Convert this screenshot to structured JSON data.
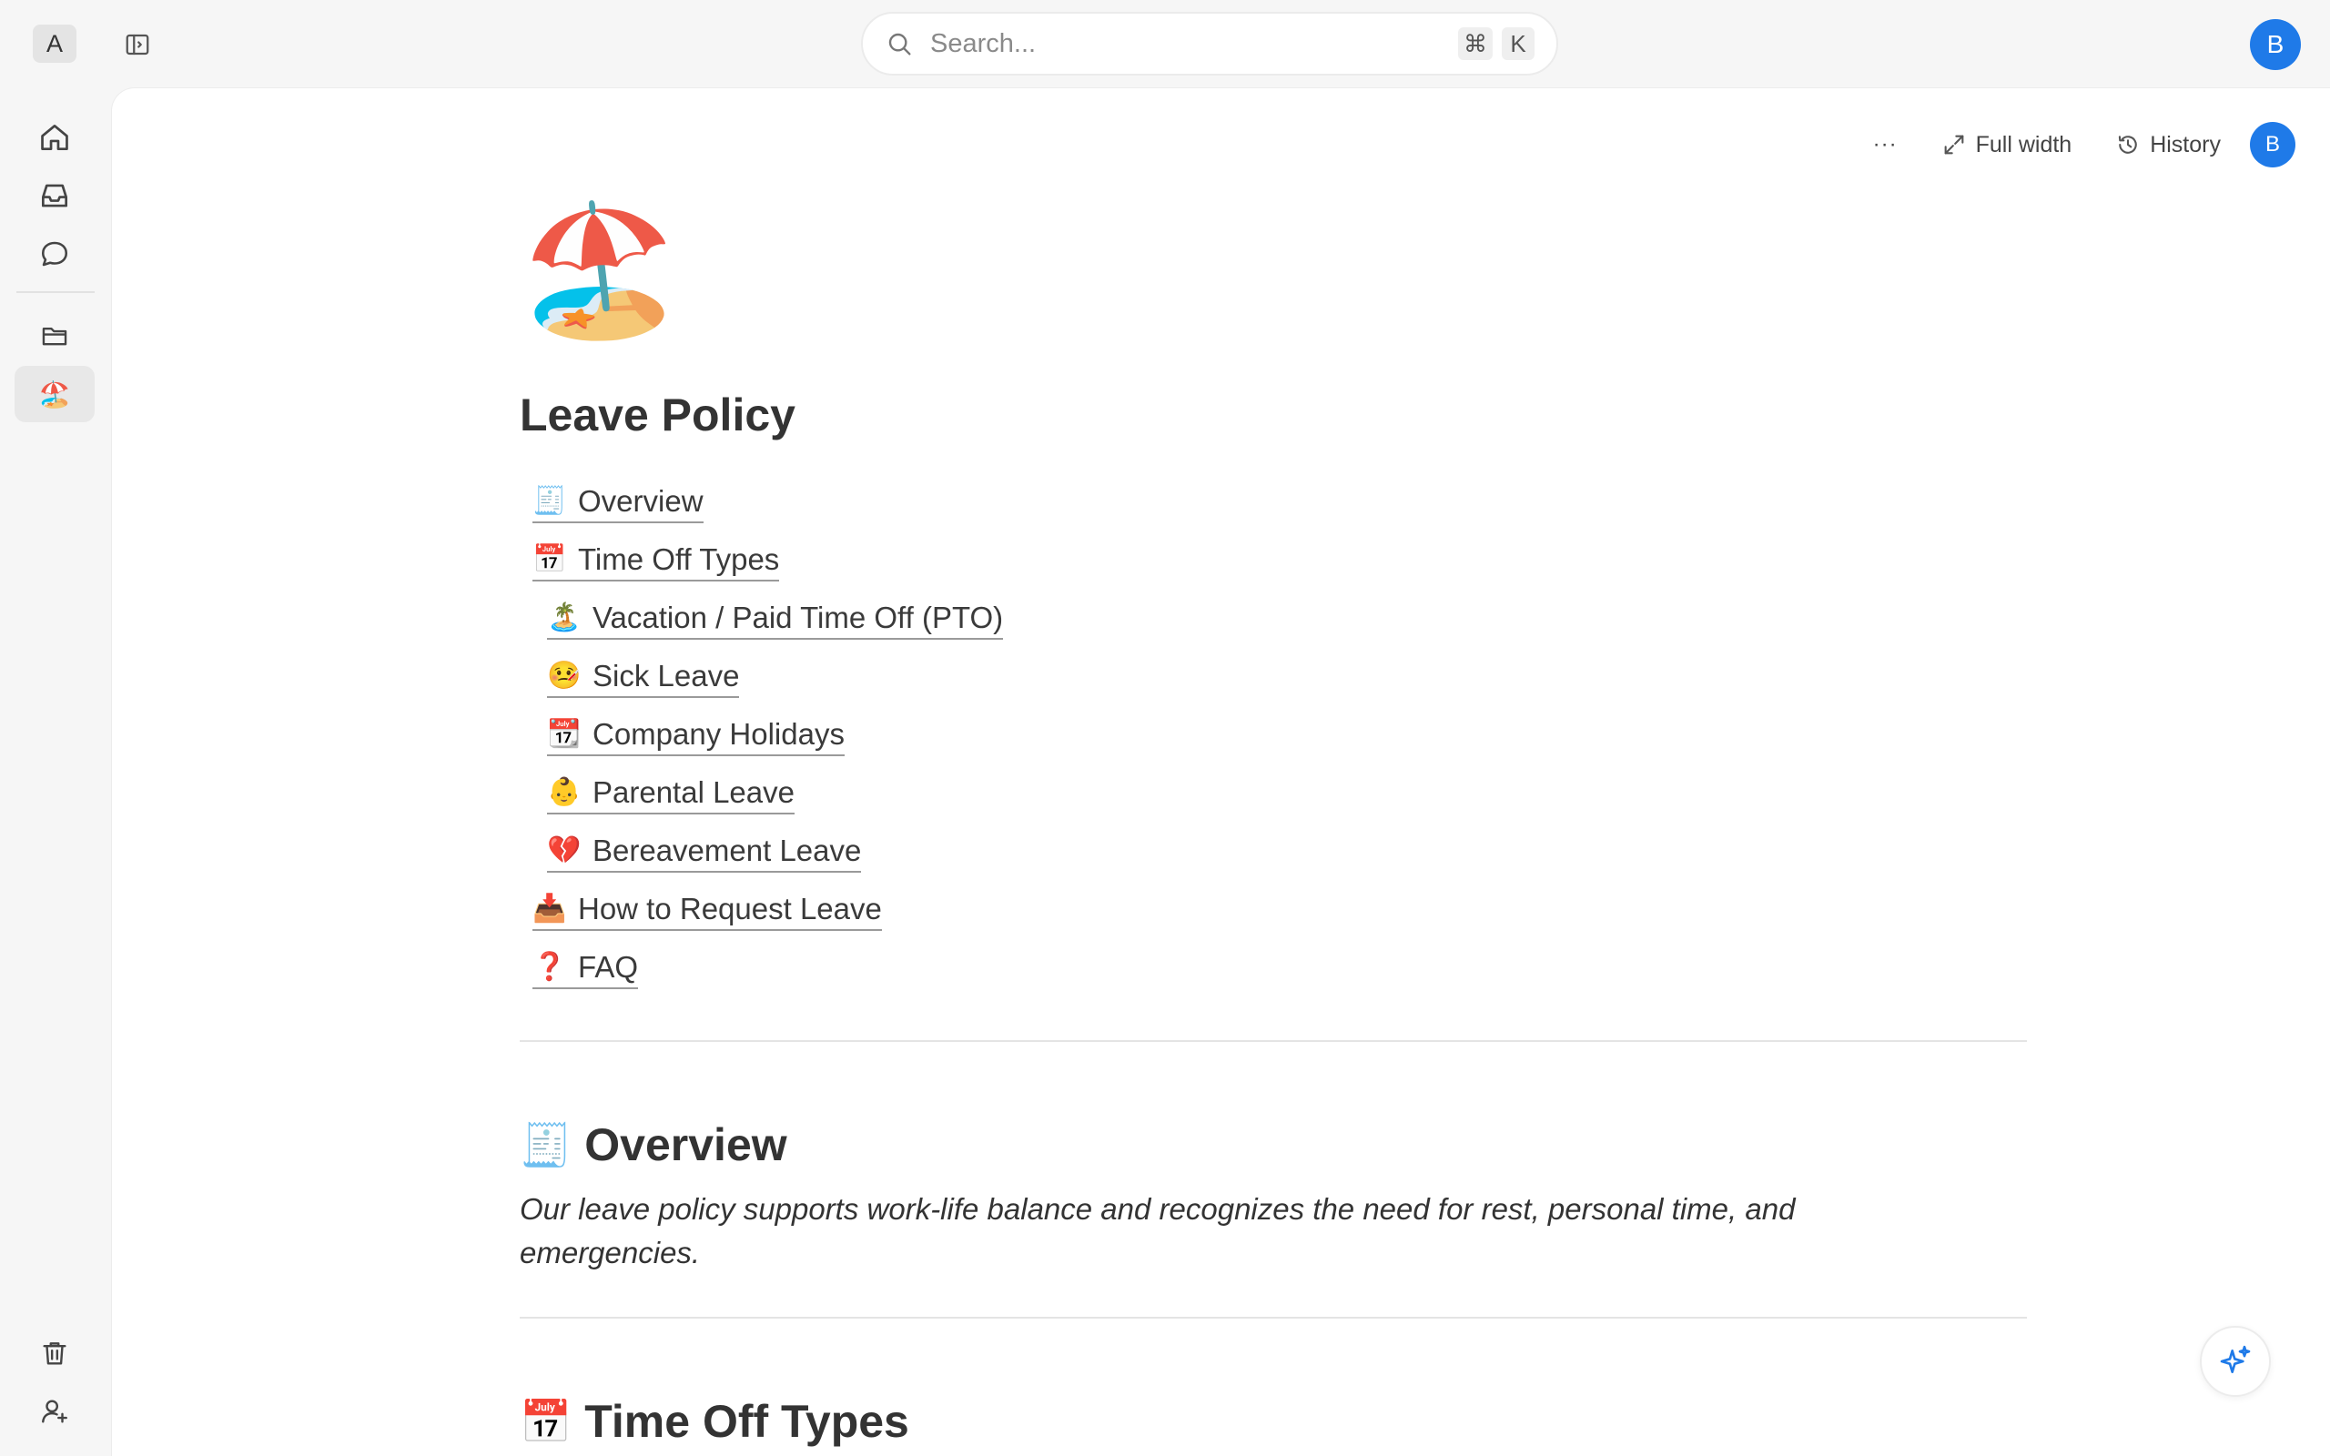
{
  "workspace": {
    "initial": "A"
  },
  "search": {
    "placeholder": "Search...",
    "shortcut_mod": "⌘",
    "shortcut_key": "K"
  },
  "user": {
    "initial": "B"
  },
  "toolbar": {
    "more_label": "···",
    "full_width_label": "Full width",
    "history_label": "History"
  },
  "rail": {
    "items": [
      {
        "icon": "home-icon"
      },
      {
        "icon": "inbox-icon"
      },
      {
        "icon": "chat-icon"
      },
      {
        "icon": "folder-icon"
      },
      {
        "icon": "page-emoji",
        "emoji": "🏖️"
      }
    ],
    "bottom": [
      {
        "icon": "trash-icon"
      },
      {
        "icon": "add-user-icon"
      }
    ]
  },
  "page": {
    "emoji": "🏖️",
    "title": "Leave Policy",
    "toc": [
      {
        "emoji": "🧾",
        "label": "Overview"
      },
      {
        "emoji": "📅",
        "label": "Time Off Types"
      },
      {
        "emoji": "🏝️",
        "label": "Vacation / Paid Time Off (PTO)"
      },
      {
        "emoji": "🤒",
        "label": "Sick Leave"
      },
      {
        "emoji": "📆",
        "label": "Company Holidays"
      },
      {
        "emoji": "👶",
        "label": "Parental Leave"
      },
      {
        "emoji": "💔",
        "label": "Bereavement Leave"
      },
      {
        "emoji": "📥",
        "label": "How to Request Leave"
      },
      {
        "emoji": "❓",
        "label": "FAQ"
      }
    ],
    "sections": [
      {
        "emoji": "🧾",
        "heading": "Overview",
        "body": "Our leave policy supports work-life balance and recognizes the need for rest, personal time, and emergencies."
      },
      {
        "emoji": "📅",
        "heading": "Time Off Types"
      }
    ]
  },
  "colors": {
    "accent": "#1f7ae8",
    "background": "#f6f6f6",
    "panel": "#ffffff"
  }
}
